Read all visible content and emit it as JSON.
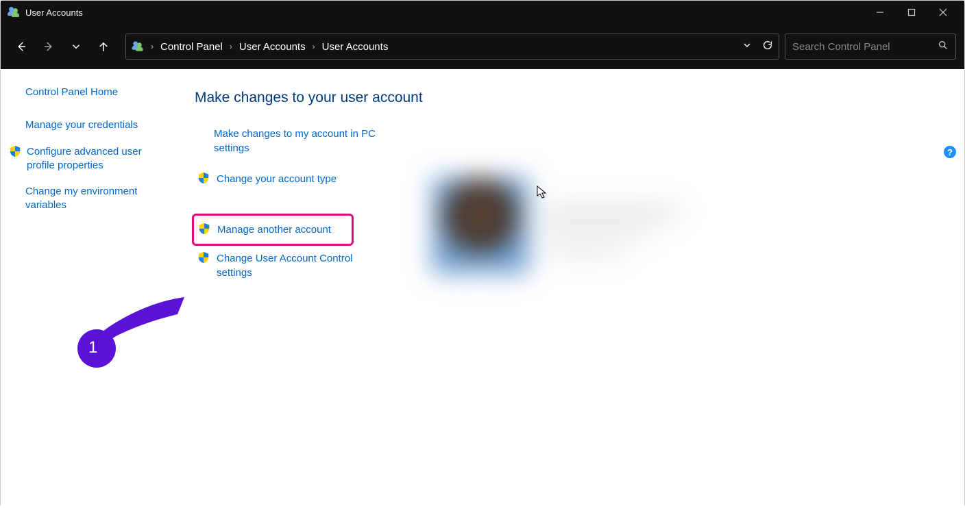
{
  "window": {
    "title": "User Accounts"
  },
  "breadcrumbs": {
    "b0": "Control Panel",
    "b1": "User Accounts",
    "b2": "User Accounts"
  },
  "search": {
    "placeholder": "Search Control Panel"
  },
  "sidebar": {
    "home": "Control Panel Home",
    "items": [
      {
        "label": "Manage your credentials",
        "shield": false
      },
      {
        "label": "Configure advanced user profile properties",
        "shield": true
      },
      {
        "label": "Change my environment variables",
        "shield": false
      }
    ]
  },
  "main": {
    "heading": "Make changes to your user account",
    "actions": [
      {
        "label": "Make changes to my account in PC settings",
        "shield": false,
        "highlight": false
      },
      {
        "label": "Change your account type",
        "shield": true,
        "highlight": false
      },
      {
        "label": "Manage another account",
        "shield": true,
        "highlight": true
      },
      {
        "label": "Change User Account Control settings",
        "shield": true,
        "highlight": false
      }
    ]
  },
  "help": {
    "symbol": "?"
  },
  "annotation": {
    "number": "1"
  }
}
